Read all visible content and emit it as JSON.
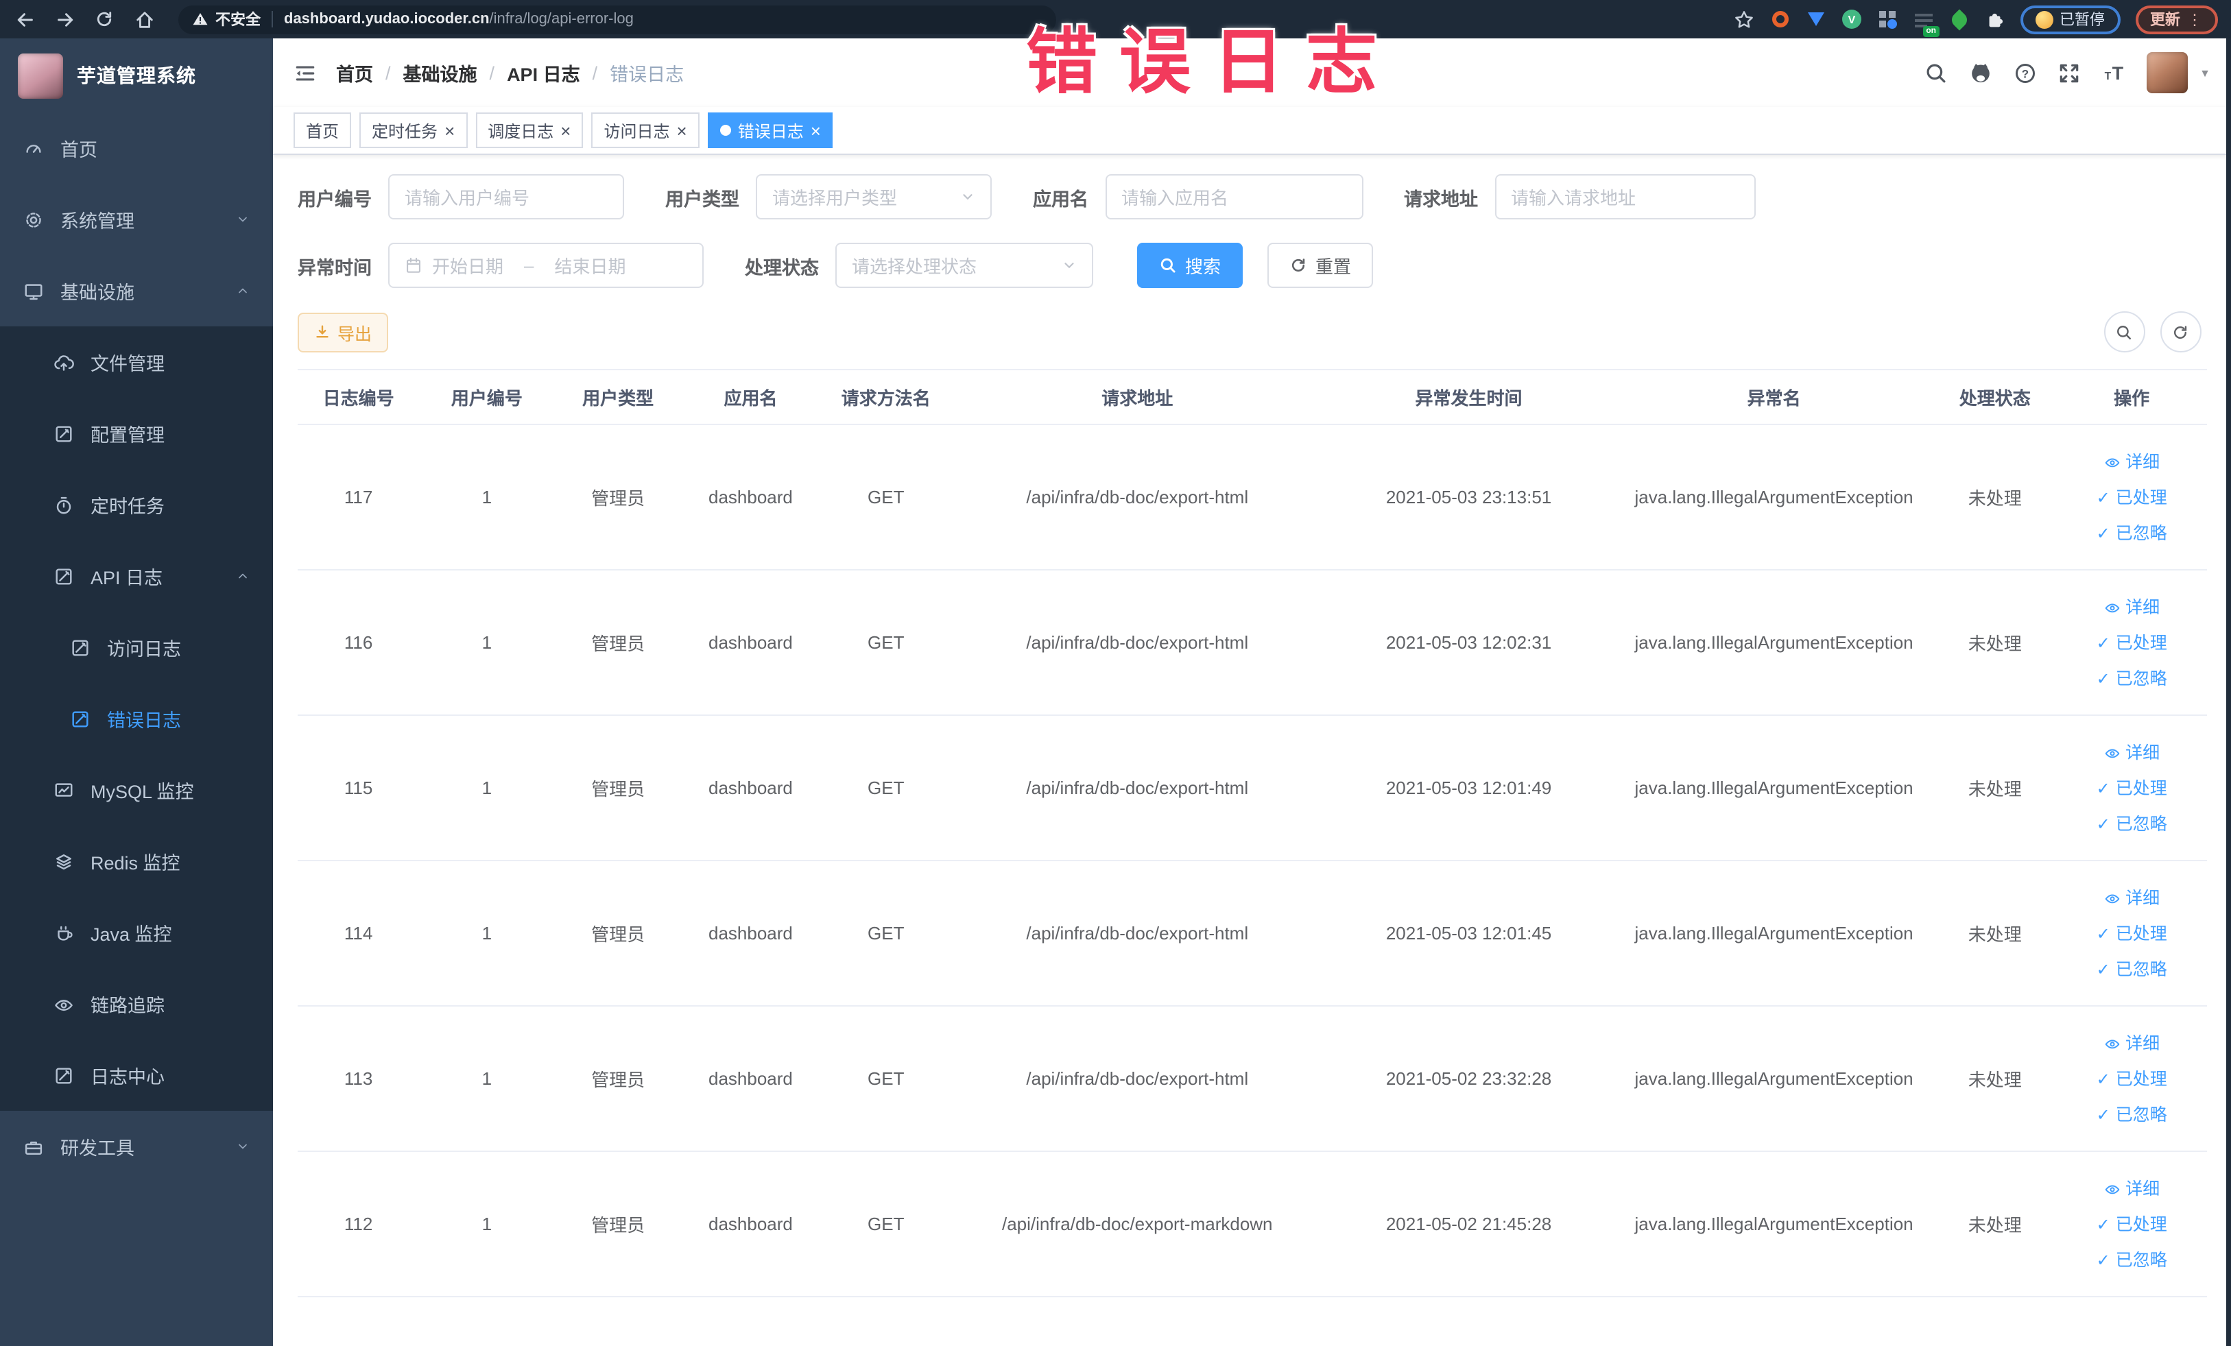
{
  "annotation": {
    "text": "错误日志",
    "color": "#f23a5c"
  },
  "colors": {
    "accent": "#409eff",
    "warning": "#e6a23c",
    "sidebar_bg": "#304156",
    "submenu_bg": "#1f2d3d",
    "chrome_bg": "#1e2a38"
  },
  "browser": {
    "security_label": "不安全",
    "url_host": "dashboard.yudao.iocoder.cn",
    "url_path": "/infra/log/api-error-log",
    "on_badge": "on",
    "pause_label": "已暂停",
    "update_label": "更新",
    "menu_dots": "⋮"
  },
  "sidebar": {
    "logo_title": "芋道管理系统",
    "items": [
      {
        "label": "首页",
        "icon": "gauge",
        "level": 1,
        "sub": false,
        "active": false,
        "chevron": null
      },
      {
        "label": "系统管理",
        "icon": "gear",
        "level": 1,
        "sub": false,
        "active": false,
        "chevron": "down"
      },
      {
        "label": "基础设施",
        "icon": "monitor",
        "level": 1,
        "sub": false,
        "active": false,
        "chevron": "up"
      },
      {
        "label": "文件管理",
        "icon": "cloudup",
        "level": 2,
        "sub": true,
        "active": false,
        "chevron": null
      },
      {
        "label": "配置管理",
        "icon": "editsq",
        "level": 2,
        "sub": true,
        "active": false,
        "chevron": null
      },
      {
        "label": "定时任务",
        "icon": "timer",
        "level": 2,
        "sub": true,
        "active": false,
        "chevron": null
      },
      {
        "label": "API 日志",
        "icon": "logdoc",
        "level": 2,
        "sub": true,
        "active": false,
        "chevron": "up"
      },
      {
        "label": "访问日志",
        "icon": "logdoc",
        "level": 3,
        "sub": true,
        "active": false,
        "chevron": null
      },
      {
        "label": "错误日志",
        "icon": "logdoc",
        "level": 3,
        "sub": true,
        "active": true,
        "chevron": null
      },
      {
        "label": "MySQL 监控",
        "icon": "dbmon",
        "level": 2,
        "sub": true,
        "active": false,
        "chevron": null
      },
      {
        "label": "Redis 监控",
        "icon": "layers",
        "level": 2,
        "sub": true,
        "active": false,
        "chevron": null
      },
      {
        "label": "Java 监控",
        "icon": "cup",
        "level": 2,
        "sub": true,
        "active": false,
        "chevron": null
      },
      {
        "label": "链路追踪",
        "icon": "eye",
        "level": 2,
        "sub": true,
        "active": false,
        "chevron": null
      },
      {
        "label": "日志中心",
        "icon": "logdoc",
        "level": 2,
        "sub": true,
        "active": false,
        "chevron": null
      },
      {
        "label": "研发工具",
        "icon": "toolbox",
        "level": 1,
        "sub": false,
        "active": false,
        "chevron": "down"
      }
    ]
  },
  "header": {
    "breadcrumb": [
      "首页",
      "基础设施",
      "API 日志",
      "错误日志"
    ]
  },
  "tabs": [
    {
      "label": "首页",
      "closable": false,
      "active": false
    },
    {
      "label": "定时任务",
      "closable": true,
      "active": false
    },
    {
      "label": "调度日志",
      "closable": true,
      "active": false
    },
    {
      "label": "访问日志",
      "closable": true,
      "active": false
    },
    {
      "label": "错误日志",
      "closable": true,
      "active": true
    }
  ],
  "filters": {
    "user_id": {
      "label": "用户编号",
      "placeholder": "请输入用户编号"
    },
    "user_type": {
      "label": "用户类型",
      "placeholder": "请选择用户类型"
    },
    "app_name": {
      "label": "应用名",
      "placeholder": "请输入应用名"
    },
    "req_url": {
      "label": "请求地址",
      "placeholder": "请输入请求地址"
    },
    "time": {
      "label": "异常时间",
      "start": "开始日期",
      "sep": "–",
      "end": "结束日期"
    },
    "status": {
      "label": "处理状态",
      "placeholder": "请选择处理状态"
    },
    "search_label": "搜索",
    "reset_label": "重置"
  },
  "toolbar": {
    "export_label": "导出"
  },
  "table": {
    "columns": [
      "日志编号",
      "用户编号",
      "用户类型",
      "应用名",
      "请求方法名",
      "请求地址",
      "异常发生时间",
      "异常名",
      "处理状态",
      "操作"
    ],
    "ops": [
      {
        "label": "详细",
        "icon": "eye"
      },
      {
        "label": "已处理",
        "icon": "check"
      },
      {
        "label": "已忽略",
        "icon": "check"
      }
    ],
    "rows": [
      {
        "id": "117",
        "user_id": "1",
        "user_type": "管理员",
        "app": "dashboard",
        "method": "GET",
        "url": "/api/infra/db-doc/export-html",
        "time": "2021-05-03 23:13:51",
        "exception": "java.lang.IllegalArgumentException",
        "status": "未处理"
      },
      {
        "id": "116",
        "user_id": "1",
        "user_type": "管理员",
        "app": "dashboard",
        "method": "GET",
        "url": "/api/infra/db-doc/export-html",
        "time": "2021-05-03 12:02:31",
        "exception": "java.lang.IllegalArgumentException",
        "status": "未处理"
      },
      {
        "id": "115",
        "user_id": "1",
        "user_type": "管理员",
        "app": "dashboard",
        "method": "GET",
        "url": "/api/infra/db-doc/export-html",
        "time": "2021-05-03 12:01:49",
        "exception": "java.lang.IllegalArgumentException",
        "status": "未处理"
      },
      {
        "id": "114",
        "user_id": "1",
        "user_type": "管理员",
        "app": "dashboard",
        "method": "GET",
        "url": "/api/infra/db-doc/export-html",
        "time": "2021-05-03 12:01:45",
        "exception": "java.lang.IllegalArgumentException",
        "status": "未处理"
      },
      {
        "id": "113",
        "user_id": "1",
        "user_type": "管理员",
        "app": "dashboard",
        "method": "GET",
        "url": "/api/infra/db-doc/export-html",
        "time": "2021-05-02 23:32:28",
        "exception": "java.lang.IllegalArgumentException",
        "status": "未处理"
      },
      {
        "id": "112",
        "user_id": "1",
        "user_type": "管理员",
        "app": "dashboard",
        "method": "GET",
        "url": "/api/infra/db-doc/export-markdown",
        "time": "2021-05-02 21:45:28",
        "exception": "java.lang.IllegalArgumentException",
        "status": "未处理"
      }
    ]
  }
}
